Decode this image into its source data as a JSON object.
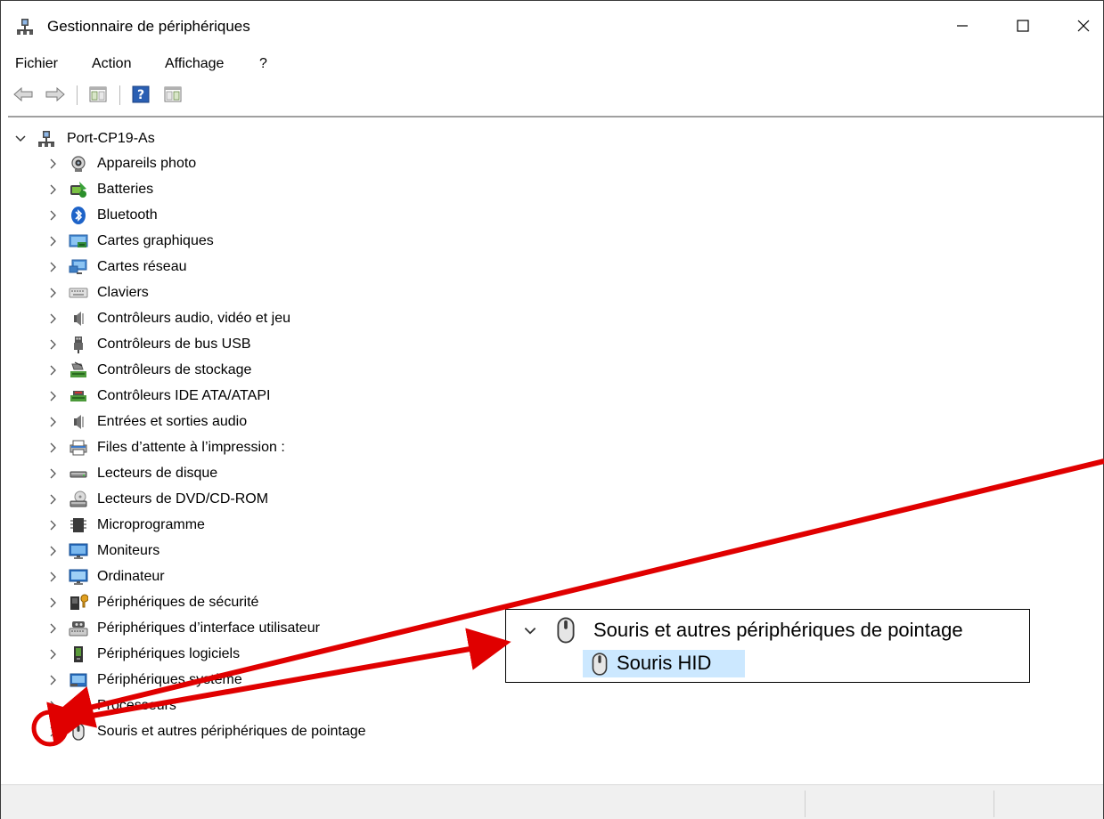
{
  "window": {
    "title": "Gestionnaire de périphériques",
    "icon": "device-manager-icon"
  },
  "menu": [
    "Fichier",
    "Action",
    "Affichage",
    "?"
  ],
  "toolbar": {
    "icons": [
      "back-arrow-icon",
      "forward-arrow-icon",
      "show-hide-console-tree-icon",
      "help-icon",
      "show-hide-action-pane-icon"
    ]
  },
  "tree": {
    "root": {
      "label": "Port-CP19-As",
      "icon": "computer-tree-icon",
      "expanded": true
    },
    "items": [
      {
        "label": "Appareils photo",
        "icon": "camera-icon"
      },
      {
        "label": "Batteries",
        "icon": "battery-icon"
      },
      {
        "label": "Bluetooth",
        "icon": "bluetooth-icon"
      },
      {
        "label": "Cartes graphiques",
        "icon": "display-adapter-icon"
      },
      {
        "label": "Cartes réseau",
        "icon": "network-adapter-icon"
      },
      {
        "label": "Claviers",
        "icon": "keyboard-icon"
      },
      {
        "label": "Contrôleurs audio, vidéo et jeu",
        "icon": "speaker-icon"
      },
      {
        "label": "Contrôleurs de bus USB",
        "icon": "usb-icon"
      },
      {
        "label": "Contrôleurs de stockage",
        "icon": "storage-controller-icon"
      },
      {
        "label": "Contrôleurs IDE ATA/ATAPI",
        "icon": "ide-controller-icon"
      },
      {
        "label": "Entrées et sorties audio",
        "icon": "speaker-icon"
      },
      {
        "label": "Files d’attente à l’impression :",
        "icon": "printer-icon"
      },
      {
        "label": "Lecteurs de disque",
        "icon": "disk-drive-icon"
      },
      {
        "label": "Lecteurs de DVD/CD-ROM",
        "icon": "dvd-drive-icon"
      },
      {
        "label": "Microprogramme",
        "icon": "firmware-chip-icon"
      },
      {
        "label": "Moniteurs",
        "icon": "monitor-icon"
      },
      {
        "label": "Ordinateur",
        "icon": "computer-icon"
      },
      {
        "label": "Périphériques de sécurité",
        "icon": "security-device-icon"
      },
      {
        "label": "Périphériques d’interface utilisateur",
        "icon": "hid-icon"
      },
      {
        "label": "Périphériques logiciels",
        "icon": "software-device-icon"
      },
      {
        "label": "Périphériques système",
        "icon": "system-device-icon"
      },
      {
        "label": "Processeurs",
        "icon": "processor-icon"
      },
      {
        "label": "Souris et autres périphériques de pointage",
        "icon": "mouse-icon"
      }
    ]
  },
  "inset": {
    "category_label": "Souris et autres périphériques de pointage",
    "child_label": "Souris HID",
    "icon": "mouse-icon"
  },
  "annotation": {
    "color": "#e00000"
  }
}
